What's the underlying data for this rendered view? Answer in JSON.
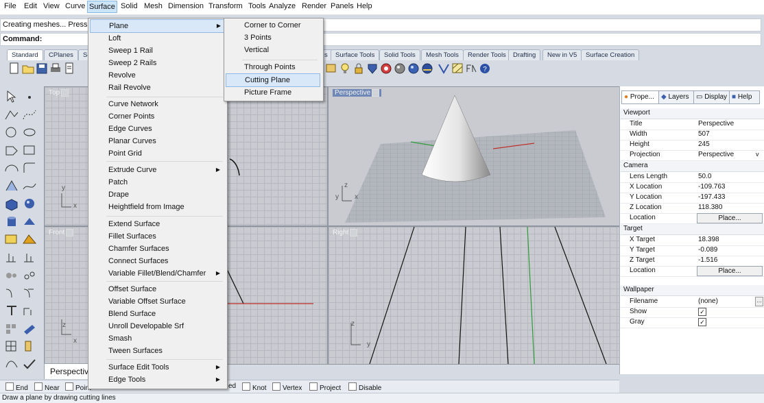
{
  "menubar": [
    "File",
    "Edit",
    "View",
    "Curve",
    "Surface",
    "Solid",
    "Mesh",
    "Dimension",
    "Transform",
    "Tools",
    "Analyze",
    "Render",
    "Panels",
    "Help"
  ],
  "command_history": "Creating meshes... Press",
  "command_prompt": "Command:",
  "toolbar_tabs": [
    "Standard",
    "CPlanes",
    "Se",
    "s",
    "Surface Tools",
    "Solid Tools",
    "Mesh Tools",
    "Render Tools",
    "Drafting",
    "New in V5",
    "Surface Creation"
  ],
  "surface_menu": [
    {
      "label": "Plane",
      "submenu": true,
      "highlight": true
    },
    {
      "label": "Loft"
    },
    {
      "label": "Sweep 1 Rail"
    },
    {
      "label": "Sweep 2 Rails"
    },
    {
      "label": "Revolve"
    },
    {
      "label": "Rail Revolve"
    },
    {
      "label": "Curve Network"
    },
    {
      "label": "Corner Points"
    },
    {
      "label": "Edge Curves"
    },
    {
      "label": "Planar Curves"
    },
    {
      "label": "Point Grid"
    },
    {
      "label": "Extrude Curve",
      "submenu": true
    },
    {
      "label": "Patch"
    },
    {
      "label": "Drape"
    },
    {
      "label": "Heightfield from Image"
    },
    {
      "label": "Extend Surface"
    },
    {
      "label": "Fillet Surfaces"
    },
    {
      "label": "Chamfer Surfaces"
    },
    {
      "label": "Connect Surfaces"
    },
    {
      "label": "Variable Fillet/Blend/Chamfer",
      "submenu": true
    },
    {
      "label": "Offset Surface"
    },
    {
      "label": "Variable Offset Surface"
    },
    {
      "label": "Blend Surface"
    },
    {
      "label": "Unroll Developable Srf"
    },
    {
      "label": "Smash"
    },
    {
      "label": "Tween Surfaces"
    },
    {
      "label": "Surface Edit Tools",
      "submenu": true
    },
    {
      "label": "Edge Tools",
      "submenu": true
    }
  ],
  "plane_submenu": [
    "Corner to Corner",
    "3 Points",
    "Vertical",
    "Through Points",
    "Cutting Plane",
    "Picture Frame"
  ],
  "viewports": {
    "top": "Top",
    "front": "Front",
    "perspective": "Perspective",
    "right": "Right",
    "axis_x": "x",
    "axis_y": "y",
    "axis_z": "z"
  },
  "view_tab": "Perspective",
  "panel": {
    "tabs": [
      "Prope...",
      "Layers",
      "Display",
      "Help"
    ],
    "viewport_section": "Viewport",
    "viewport": [
      {
        "k": "Title",
        "v": "Perspective"
      },
      {
        "k": "Width",
        "v": "507"
      },
      {
        "k": "Height",
        "v": "245"
      },
      {
        "k": "Projection",
        "v": "Perspective"
      }
    ],
    "camera_section": "Camera",
    "camera": [
      {
        "k": "Lens Length",
        "v": "50.0"
      },
      {
        "k": "X Location",
        "v": "-109.763"
      },
      {
        "k": "Y Location",
        "v": "-197.433"
      },
      {
        "k": "Z Location",
        "v": "118.380"
      },
      {
        "k": "Location",
        "v": "Place..."
      }
    ],
    "target_section": "Target",
    "target": [
      {
        "k": "X Target",
        "v": "18.398"
      },
      {
        "k": "Y Target",
        "v": "-0.089"
      },
      {
        "k": "Z Target",
        "v": "-1.516"
      },
      {
        "k": "Location",
        "v": "Place..."
      }
    ],
    "wallpaper_section": "Wallpaper",
    "wallpaper": [
      {
        "k": "Filename",
        "v": "(none)"
      },
      {
        "k": "Show",
        "v": "✓"
      },
      {
        "k": "Gray",
        "v": "✓"
      }
    ]
  },
  "osnaps": [
    "End",
    "Near",
    "Point",
    "ed",
    "Knot",
    "Vertex",
    "Project",
    "Disable"
  ],
  "status_text": "Draw a plane by drawing cutting lines",
  "colors": {
    "menu_highlight": "#cce4f7",
    "viewport_bg": "#c9cbd1",
    "x_axis": "#c0302b",
    "y_axis": "#2e9a3a"
  }
}
